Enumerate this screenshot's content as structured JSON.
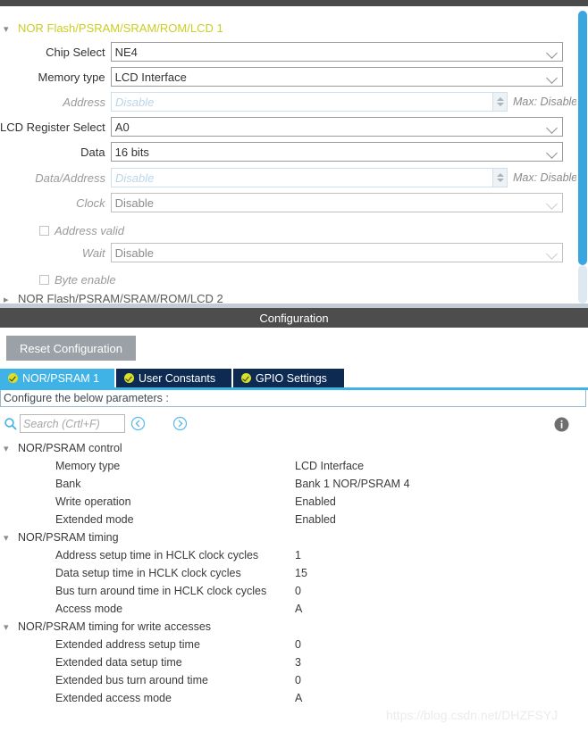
{
  "top_panel": {
    "group1": {
      "label": "NOR Flash/PSRAM/SRAM/ROM/LCD 1",
      "chevron": "chevron-down-icon",
      "expanded": true
    },
    "group2": {
      "label": "NOR Flash/PSRAM/SRAM/ROM/LCD 2",
      "chevron": "chevron-right-icon",
      "expanded": false
    },
    "fields": [
      {
        "label": "Chip Select",
        "value": "NE4",
        "type": "select",
        "disabled": false
      },
      {
        "label": "Memory type",
        "value": "LCD Interface",
        "type": "select",
        "disabled": false
      },
      {
        "label": "Address",
        "value": "Disable",
        "type": "spinner",
        "disabled": true,
        "max_label": "Max: Disable"
      },
      {
        "label": "LCD Register Select",
        "value": "A0",
        "type": "select",
        "disabled": false
      },
      {
        "label": "Data",
        "value": "16 bits",
        "type": "select",
        "disabled": false
      },
      {
        "label": "Data/Address",
        "value": "Disable",
        "type": "spinner",
        "disabled": true,
        "max_label": "Max: Disable"
      },
      {
        "label": "Clock",
        "value": "Disable",
        "type": "select",
        "disabled": true
      },
      {
        "label": "Address valid",
        "value": "",
        "type": "checkbox",
        "disabled": true,
        "checked": false
      },
      {
        "label": "Wait",
        "value": "Disable",
        "type": "select",
        "disabled": true
      },
      {
        "label": "Byte enable",
        "value": "",
        "type": "checkbox",
        "disabled": true,
        "checked": false
      }
    ]
  },
  "config_bar": {
    "title": "Configuration"
  },
  "toolbar": {
    "reset_label": "Reset Configuration"
  },
  "tabs": [
    {
      "label": "NOR/PSRAM 1",
      "active": true,
      "status_icon": "check-circle-icon"
    },
    {
      "label": "User Constants",
      "active": false,
      "status_icon": "check-circle-icon"
    },
    {
      "label": "GPIO Settings",
      "active": false,
      "status_icon": "check-circle-icon"
    }
  ],
  "configure_strip": {
    "text": "Configure the below parameters :"
  },
  "search": {
    "icon": "search-icon",
    "placeholder": "Search (Crtl+F)",
    "value": "",
    "prev_icon": "chevron-left-circle-icon",
    "next_icon": "chevron-right-circle-icon",
    "info_icon": "info-circle-icon"
  },
  "tree": [
    {
      "group": "NOR/PSRAM control",
      "chevron": "chevron-down-icon",
      "rows": [
        {
          "key": "Memory type",
          "value": "LCD Interface"
        },
        {
          "key": "Bank",
          "value": "Bank 1 NOR/PSRAM 4"
        },
        {
          "key": "Write operation",
          "value": "Enabled"
        },
        {
          "key": "Extended mode",
          "value": "Enabled"
        }
      ]
    },
    {
      "group": "NOR/PSRAM timing",
      "chevron": "chevron-down-icon",
      "rows": [
        {
          "key": "Address setup time in HCLK clock cycles",
          "value": "1"
        },
        {
          "key": "Data setup time in HCLK clock cycles",
          "value": "15"
        },
        {
          "key": "Bus turn around time in HCLK clock cycles",
          "value": "0"
        },
        {
          "key": "Access mode",
          "value": "A"
        }
      ]
    },
    {
      "group": "NOR/PSRAM timing for write accesses",
      "chevron": "chevron-down-icon",
      "rows": [
        {
          "key": "Extended address setup time",
          "value": "0"
        },
        {
          "key": "Extended data setup time",
          "value": "3"
        },
        {
          "key": "Extended bus turn around time",
          "value": "0"
        },
        {
          "key": "Extended access mode",
          "value": "A"
        }
      ]
    }
  ],
  "watermark": {
    "text": "https://blog.csdn.net/DHZFSYJ"
  },
  "colors": {
    "accent_blue": "#3fb3e5",
    "tab_inactive": "#0d2a52",
    "header_green": "#c9cf23",
    "title_bar": "#4d4d4d",
    "status_badge": "#d9df2a"
  }
}
